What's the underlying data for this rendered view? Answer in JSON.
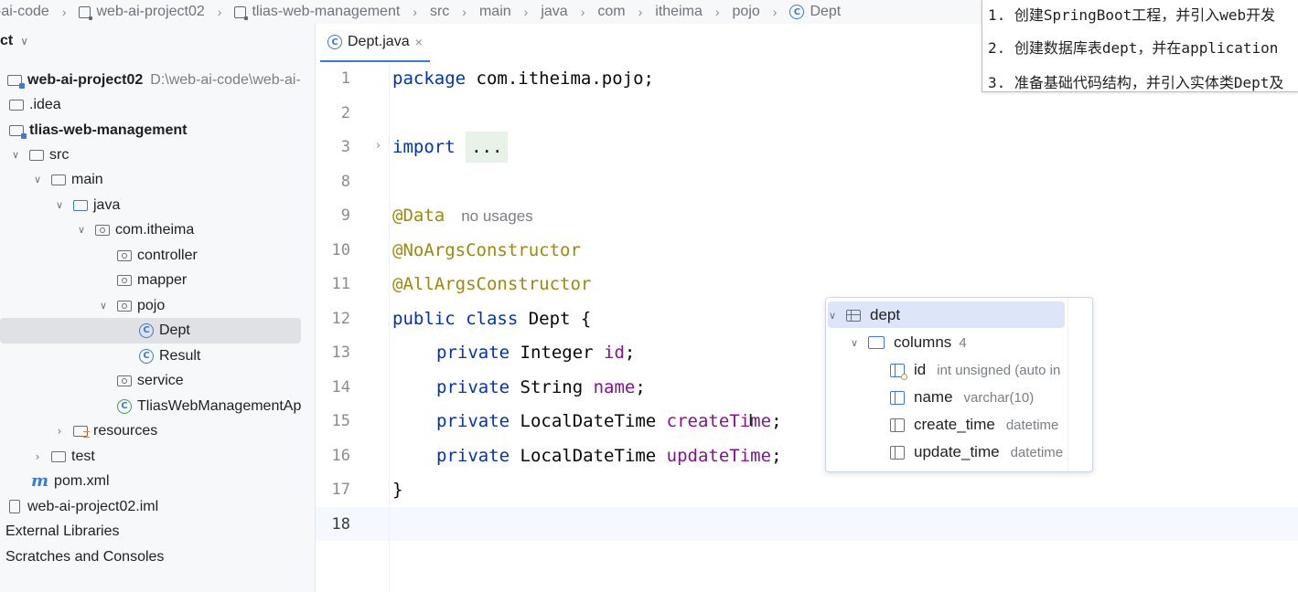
{
  "breadcrumb": [
    "-ai-code",
    "web-ai-project02",
    "tlias-web-management",
    "src",
    "main",
    "java",
    "com",
    "itheima",
    "pojo",
    "Dept"
  ],
  "project": {
    "header": "ct",
    "items": [
      {
        "label": "web-ai-project02",
        "path": "D:\\web-ai-code\\web-ai-"
      },
      {
        "label": ".idea"
      },
      {
        "label": "tlias-web-management"
      },
      {
        "label": "src"
      },
      {
        "label": "main"
      },
      {
        "label": "java"
      },
      {
        "label": "com.itheima"
      },
      {
        "label": "controller"
      },
      {
        "label": "mapper"
      },
      {
        "label": "pojo"
      },
      {
        "label": "Dept"
      },
      {
        "label": "Result"
      },
      {
        "label": "service"
      },
      {
        "label": "TliasWebManagementAp"
      },
      {
        "label": "resources"
      },
      {
        "label": "test"
      },
      {
        "label": "pom.xml"
      },
      {
        "label": "web-ai-project02.iml"
      },
      {
        "label": "External Libraries"
      },
      {
        "label": "Scratches and Consoles"
      }
    ]
  },
  "tab": {
    "label": "Dept.java",
    "close": "×"
  },
  "editor": {
    "line_numbers": [
      "1",
      "2",
      "3",
      "8",
      "9",
      "10",
      "11",
      "12",
      "13",
      "14",
      "15",
      "16",
      "17",
      "18"
    ],
    "package_kw": "package",
    "package_name": " com.itheima.pojo;",
    "import_kw": "import",
    "import_fold": "...",
    "ann_data": "@Data",
    "no_usages": "no usages",
    "ann_noargs": "@NoArgsConstructor",
    "ann_allargs": "@AllArgsConstructor",
    "class_kw": "public class",
    "class_name": " Dept {",
    "private_kw": "private",
    "fields": [
      {
        "type": " Integer ",
        "name": "id"
      },
      {
        "type": " String ",
        "name": "name"
      },
      {
        "type": " LocalDateTime ",
        "name": "createTime"
      },
      {
        "type": " LocalDateTime ",
        "name": "updateTime"
      }
    ],
    "semicolon": ";",
    "close_brace": "}"
  },
  "db_popup": {
    "table": "dept",
    "columns_label": "columns",
    "columns_count": "4",
    "columns": [
      {
        "name": "id",
        "type": "int unsigned (auto in"
      },
      {
        "name": "name",
        "type": "varchar(10)"
      },
      {
        "name": "create_time",
        "type": "datetime"
      },
      {
        "name": "update_time",
        "type": "datetime"
      }
    ]
  },
  "tasks": [
    "1. 创建SpringBoot工程，并引入web开发",
    "2. 创建数据库表dept，并在application",
    "3. 准备基础代码结构，并引入实体类Dept及"
  ],
  "colors": {
    "keyword": "#0033b3",
    "annotation": "#9e880d",
    "field": "#871094",
    "accent": "#3a7bd5"
  }
}
